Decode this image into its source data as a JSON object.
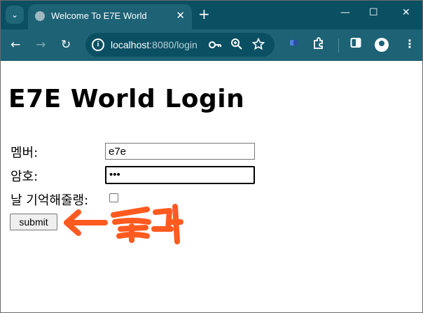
{
  "browser": {
    "tab_search_icon": "chevron-down-icon",
    "tab": {
      "title": "Welcome To E7E World",
      "close": "✕"
    },
    "new_tab": "+",
    "window_controls": {
      "minimize": "—",
      "maximize": "☐",
      "close": "✕"
    },
    "nav": {
      "back": "←",
      "forward": "→",
      "reload": "↻"
    },
    "address": {
      "host": "localhost",
      "path": ":8080/login"
    },
    "colors": {
      "frame": "#0b4f63",
      "toolbar": "#1d6275",
      "annotation": "#ff5a1f"
    }
  },
  "page": {
    "title": "E7E World Login",
    "form": {
      "member_label": "멤버:",
      "member_value": "e7e",
      "password_label": "암호:",
      "password_value": "•••",
      "remember_label": "날 기억해줄랭:",
      "remember_checked": false,
      "submit_label": "submit"
    },
    "annotation": {
      "text": "클릭"
    }
  }
}
